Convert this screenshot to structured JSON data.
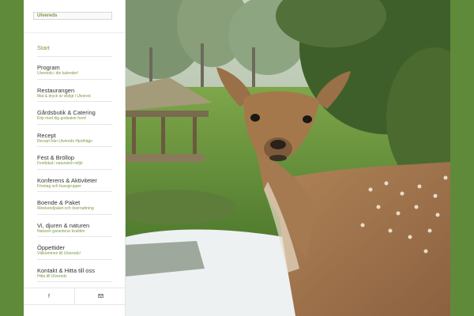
{
  "site": {
    "logo_text": "Ulvereds"
  },
  "nav": [
    {
      "label": "Start",
      "sub": ""
    },
    {
      "label": "Program",
      "sub": "Ulvereds i din kalender!"
    },
    {
      "label": "Restaurangen",
      "sub": "Mat & dryck är viktigt i Ulvered"
    },
    {
      "label": "Gårdsbutik & Catering",
      "sub": "Köp med dig godsaker hem!"
    },
    {
      "label": "Recept",
      "sub": "Recept från Ulvereds Hjorthägn"
    },
    {
      "label": "Fest & Bröllop",
      "sub": "Festlokal i naturskön miljö"
    },
    {
      "label": "Konferens & Aktiviteter",
      "sub": "Företag och bussgrupper"
    },
    {
      "label": "Boende & Paket",
      "sub": "Weekendpaket och övernattning"
    },
    {
      "label": "Vi, djuren & naturen",
      "sub": "Naturen garanterar kvalitén"
    },
    {
      "label": "Öppettider",
      "sub": "Välkommen till Ulvereds!"
    },
    {
      "label": "Kontakt & Hitta till oss",
      "sub": "Hitta till Ulvereds"
    }
  ],
  "social": {
    "facebook_glyph": "f",
    "mail_icon": "mail-icon"
  },
  "colors": {
    "accent": "#7a9a3f",
    "frame": "#5f8a3a"
  }
}
